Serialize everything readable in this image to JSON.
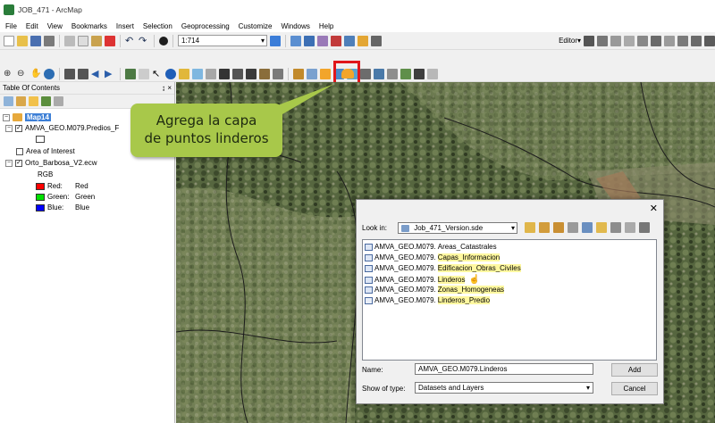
{
  "window": {
    "title": "JOB_471 - ArcMap"
  },
  "menu": [
    "File",
    "Edit",
    "View",
    "Bookmarks",
    "Insert",
    "Selection",
    "Geoprocessing",
    "Customize",
    "Windows",
    "Help"
  ],
  "toolbar": {
    "scale": "1:714",
    "editor_label": "Editor▾"
  },
  "toc": {
    "title": "Table Of Contents",
    "pin": "↨ ×",
    "map_name": "Map14",
    "layers": [
      {
        "name": "AMVA_GEO.M079.Predios_F"
      },
      {
        "name": "Area of Interest"
      },
      {
        "name": "Orto_Barbosa_V2.ecw"
      }
    ],
    "rgb_label": "RGB",
    "bands": [
      {
        "label": "Red:",
        "value": "Red",
        "color": "#ff0000"
      },
      {
        "label": "Green:",
        "value": "Green",
        "color": "#00e000"
      },
      {
        "label": "Blue:",
        "value": "Blue",
        "color": "#0000ff"
      }
    ]
  },
  "callout": {
    "line1": "Agrega la capa",
    "line2": "de puntos linderos"
  },
  "dialog": {
    "look_in_label": "Look in:",
    "look_in_value": "Job_471_Version.sde",
    "items": [
      {
        "prefix": "AMVA_GEO.M079.",
        "suffix": "Areas_Catastrales",
        "highlight": false
      },
      {
        "prefix": "AMVA_GEO.M079.",
        "suffix": "Capas_Informacion",
        "highlight": true
      },
      {
        "prefix": "AMVA_GEO.M079.",
        "suffix": "Edificacion_Obras_Civiles",
        "highlight": true
      },
      {
        "prefix": "AMVA_GEO.M079.",
        "suffix": "Linderos",
        "highlight": true
      },
      {
        "prefix": "AMVA_GEO.M079.",
        "suffix": "Zonas_Homogeneas",
        "highlight": true
      },
      {
        "prefix": "AMVA_GEO.M079.",
        "suffix": "Linderos_Predio",
        "highlight": true
      }
    ],
    "name_label": "Name:",
    "name_value": "AMVA_GEO.M079.Linderos",
    "type_label": "Show of type:",
    "type_value": "Datasets and Layers",
    "add_label": "Add",
    "cancel_label": "Cancel"
  }
}
